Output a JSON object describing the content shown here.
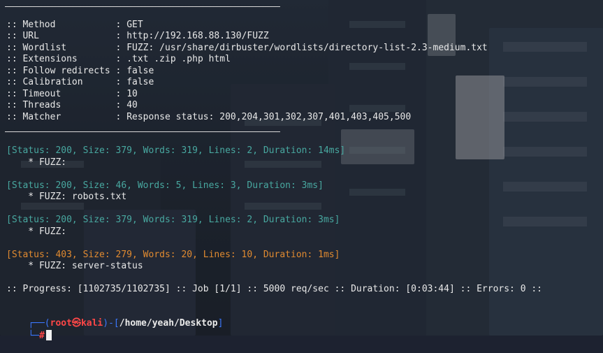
{
  "config": [
    {
      "key": ":: Method           ",
      "value": "GET"
    },
    {
      "key": ":: URL              ",
      "value": "http://192.168.88.130/FUZZ"
    },
    {
      "key": ":: Wordlist         ",
      "value": "FUZZ: /usr/share/dirbuster/wordlists/directory-list-2.3-medium.txt"
    },
    {
      "key": ":: Extensions       ",
      "value": ".txt .zip .php html"
    },
    {
      "key": ":: Follow redirects ",
      "value": "false"
    },
    {
      "key": ":: Calibration      ",
      "value": "false"
    },
    {
      "key": ":: Timeout          ",
      "value": "10"
    },
    {
      "key": ":: Threads          ",
      "value": "40"
    },
    {
      "key": ":: Matcher          ",
      "value": "Response status: 200,204,301,302,307,401,403,405,500"
    }
  ],
  "separator": ": ",
  "results": [
    {
      "status": "[Status: 200, Size: 379, Words: 319, Lines: 2, Duration: 14ms]",
      "fuzz": "    * FUZZ: ",
      "color": "#48a8a0"
    },
    {
      "status": "[Status: 200, Size: 46, Words: 5, Lines: 3, Duration: 3ms]",
      "fuzz": "    * FUZZ: robots.txt",
      "color": "#48a8a0"
    },
    {
      "status": "[Status: 200, Size: 379, Words: 319, Lines: 2, Duration: 3ms]",
      "fuzz": "    * FUZZ: ",
      "color": "#48a8a0"
    },
    {
      "status": "[Status: 403, Size: 279, Words: 20, Lines: 10, Duration: 1ms]",
      "fuzz": "    * FUZZ: server-status",
      "color": "#e08a30"
    }
  ],
  "progress": ":: Progress: [1102735/1102735] :: Job [1/1] :: 5000 req/sec :: Duration: [0:03:44] :: Errors: 0 ::",
  "prompt": {
    "top_left": "┌──(",
    "user": "root",
    "at_symbol": "㉿",
    "host": "kali",
    "mid": ")-[",
    "path": "/home/yeah/Desktop",
    "close": "]",
    "bottom_left": "└─",
    "hash": "#"
  },
  "colors": {
    "status_ok": "#48a8a0",
    "status_forbidden": "#e08a30",
    "prompt_frame": "#3b78ff",
    "prompt_user": "#ff4747"
  }
}
